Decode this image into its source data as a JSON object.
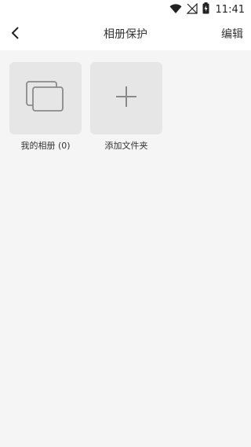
{
  "status_bar": {
    "time": "11:41",
    "icons": [
      "wifi-icon",
      "signal-off-icon",
      "battery-charging-icon"
    ]
  },
  "app_bar": {
    "back_icon": "chevron-left-icon",
    "title": "相册保护",
    "edit_label": "编辑"
  },
  "albums": [
    {
      "label": "我的相册 (0)",
      "icon": "album-stack-icon"
    },
    {
      "label": "添加文件夹",
      "icon": "plus-icon"
    }
  ],
  "colors": {
    "background": "#f5f5f5",
    "tile": "#e6e6e6",
    "icon": "#8a8a8a",
    "text": "#333333"
  }
}
